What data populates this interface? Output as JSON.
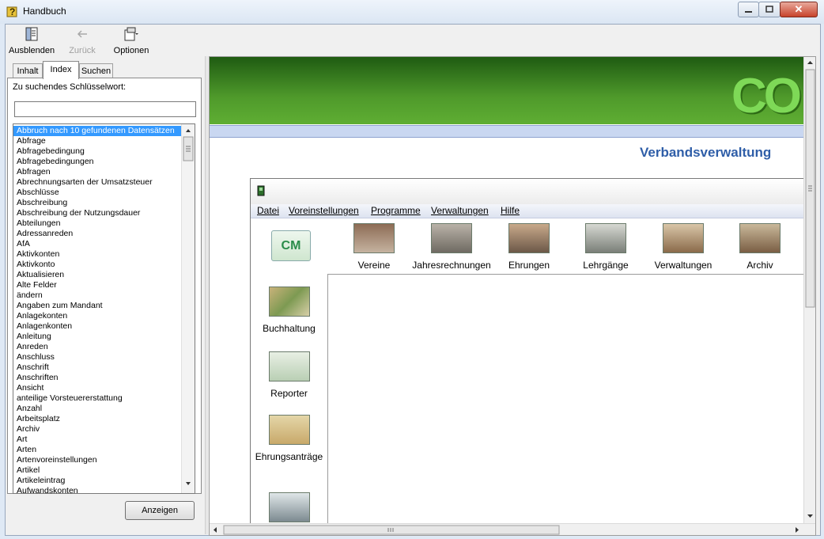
{
  "window": {
    "title": "Handbuch",
    "close_glyph": "✕"
  },
  "toolbar": {
    "hide_label": "Ausblenden",
    "back_label": "Zurück",
    "options_label": "Optionen"
  },
  "tabs": {
    "inhalt": "Inhalt",
    "index": "Index",
    "suchen": "Suchen"
  },
  "keyword": {
    "label": "Zu suchendes Schlüsselwort:",
    "value": ""
  },
  "index_items": [
    "Abbruch nach 10 gefundenen Datensätzen",
    "Abfrage",
    "Abfragebedingung",
    "Abfragebedingungen",
    "Abfragen",
    "Abrechnungsarten der Umsatzsteuer",
    "Abschlüsse",
    "Abschreibung",
    "Abschreibung der Nutzungsdauer",
    "Abteilungen",
    "Adressanreden",
    "AfA",
    "Aktivkonten",
    "Aktivkonto",
    "Aktualisieren",
    "Alte Felder",
    "ändern",
    "Angaben zum Mandant",
    "Anlagekonten",
    "Anlagenkonten",
    "Anleitung",
    "Anreden",
    "Anschluss",
    "Anschrift",
    "Anschriften",
    "Ansicht",
    "anteilige Vorsteuererstattung",
    "Anzahl",
    "Arbeitsplatz",
    "Archiv",
    "Art",
    "Arten",
    "Artenvoreinstellungen",
    "Artikel",
    "Artikeleintrag",
    "Aufwandskonten"
  ],
  "display_button": "Anzeigen",
  "content": {
    "logo_text": "CO",
    "heading": "Verbandsverwaltung",
    "app": {
      "menu": [
        "Datei",
        "Voreinstellungen",
        "Programme",
        "Verwaltungen",
        "Hilfe"
      ],
      "cm_logo": "CM",
      "nav": [
        "Vereine",
        "Jahresrechnungen",
        "Ehrungen",
        "Lehrgänge",
        "Verwaltungen",
        "Archiv"
      ],
      "side": [
        "Buchhaltung",
        "Reporter",
        "Ehrungsanträge"
      ]
    }
  },
  "colors": {
    "accent": "#2f5ea8",
    "banner_green": "#4f9a2b",
    "selection": "#3399ff"
  }
}
